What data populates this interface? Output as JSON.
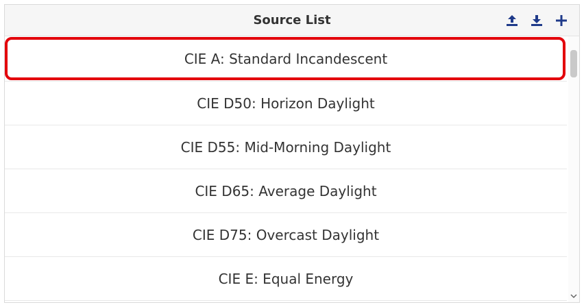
{
  "header": {
    "title": "Source List",
    "actions": [
      {
        "icon": "upload-icon"
      },
      {
        "icon": "download-icon"
      },
      {
        "icon": "plus-icon"
      }
    ]
  },
  "list": {
    "selected_index": 0,
    "items": [
      {
        "label": "CIE A: Standard Incandescent"
      },
      {
        "label": "CIE D50: Horizon Daylight"
      },
      {
        "label": "CIE D55: Mid-Morning Daylight"
      },
      {
        "label": "CIE D65: Average Daylight"
      },
      {
        "label": "CIE D75: Overcast Daylight"
      },
      {
        "label": "CIE E: Equal Energy"
      }
    ]
  },
  "colors": {
    "accent_icon": "#1f3a8a",
    "selection_ring": "#e3000b",
    "text": "#333333"
  }
}
